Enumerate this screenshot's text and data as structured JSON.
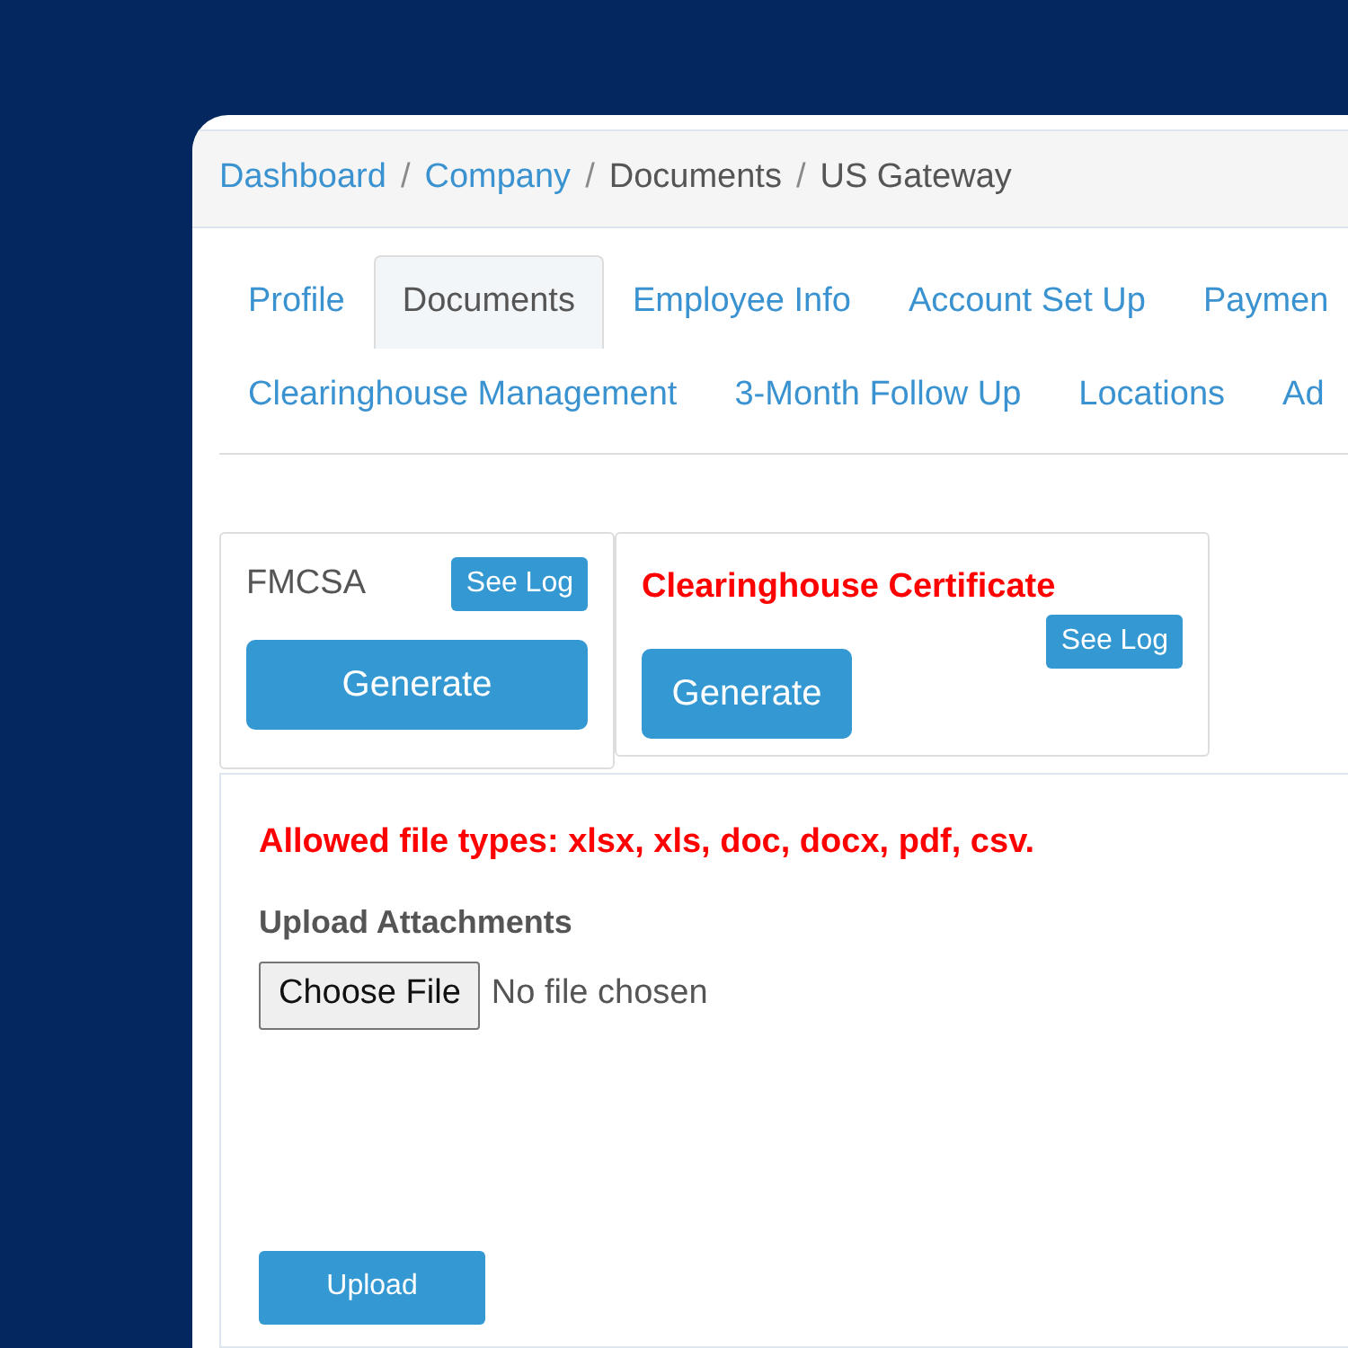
{
  "breadcrumb": [
    {
      "label": "Dashboard",
      "kind": "link",
      "separator_after": "/"
    },
    {
      "label": "Company",
      "kind": "link",
      "separator_after": "/"
    },
    {
      "label": "Documents",
      "kind": "text",
      "separator_after": "/"
    },
    {
      "label": "US Gateway",
      "kind": "text"
    }
  ],
  "tab_rows": [
    [
      {
        "label": "Profile",
        "selected": false
      },
      {
        "label": "Documents",
        "selected": true
      },
      {
        "label": "Employee Info",
        "selected": false
      },
      {
        "label": "Account Set Up",
        "selected": false
      },
      {
        "label": "Paymen",
        "selected": false
      }
    ],
    [
      {
        "label": "Clearinghouse Management",
        "selected": false
      },
      {
        "label": "3-Month Follow Up",
        "selected": false
      },
      {
        "label": "Locations",
        "selected": false
      },
      {
        "label": "Ad",
        "selected": false
      }
    ]
  ],
  "cards": [
    {
      "title": "FMCSA",
      "kind": "plain",
      "log_button": "See Log",
      "generate_button": "Generate"
    },
    {
      "title": "Clearinghouse Certificate",
      "kind": "alert",
      "log_button": "See Log",
      "generate_button": "Generate"
    }
  ],
  "upload": {
    "notice": "Allowed file types: xlsx, xls, doc, docx, pdf, csv.",
    "label": "Upload Attachments",
    "choose_button": "Choose File",
    "file_status": "No file chosen",
    "submit_button": "Upload"
  }
}
